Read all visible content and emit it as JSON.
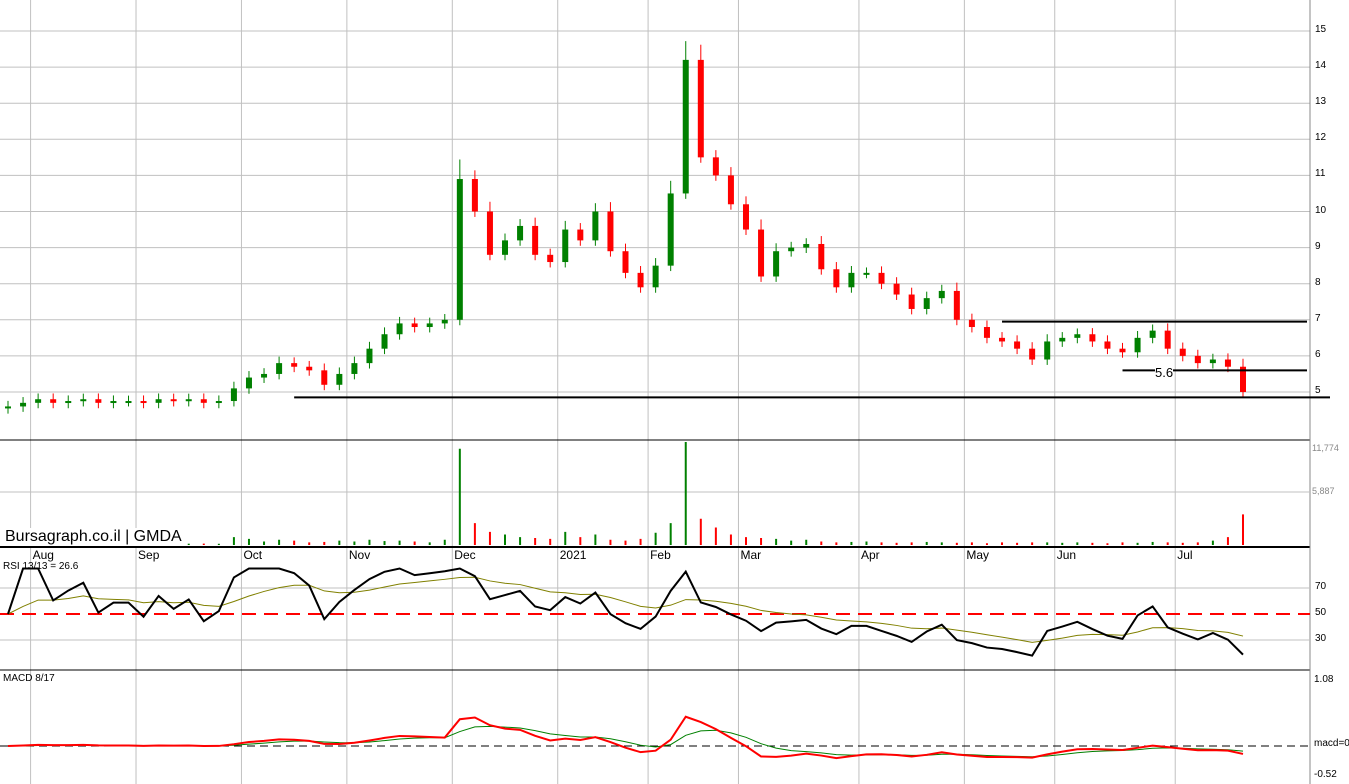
{
  "chart_data": {
    "type": "candlestick",
    "title": "GMDA",
    "brand": "Bursagraph.co.il | GMDA",
    "price_axis": {
      "ticks": [
        5,
        6,
        7,
        8,
        9,
        10,
        11,
        12,
        13,
        14,
        15
      ],
      "range": [
        4.2,
        15.6
      ]
    },
    "closes": [
      4.6,
      4.7,
      4.8,
      4.7,
      4.75,
      4.8,
      4.7,
      4.75,
      4.75,
      4.7,
      4.8,
      4.75,
      4.8,
      4.7,
      4.75,
      5.1,
      5.4,
      5.5,
      5.8,
      5.7,
      5.6,
      5.2,
      5.5,
      5.8,
      6.2,
      6.6,
      6.9,
      6.8,
      6.9,
      7.0,
      10.9,
      10.0,
      8.8,
      9.2,
      9.6,
      8.8,
      8.6,
      9.5,
      9.2,
      10.0,
      8.9,
      8.3,
      7.9,
      8.5,
      10.5,
      14.2,
      11.5,
      11.0,
      10.2,
      9.5,
      8.2,
      8.9,
      9.0,
      9.1,
      8.4,
      7.9,
      8.3,
      8.3,
      8.0,
      7.7,
      7.3,
      7.6,
      7.8,
      7.0,
      6.8,
      6.5,
      6.4,
      6.2,
      5.9,
      6.4,
      6.5,
      6.6,
      6.4,
      6.2,
      6.1,
      6.5,
      6.7,
      6.2,
      6.0,
      5.8,
      5.9,
      5.7,
      5.0
    ],
    "volumes": [
      200,
      150,
      300,
      250,
      200,
      180,
      220,
      160,
      150,
      200,
      180,
      170,
      150,
      160,
      140,
      900,
      700,
      400,
      600,
      500,
      300,
      350,
      500,
      400,
      600,
      450,
      500,
      400,
      300,
      600,
      11000,
      2500,
      1500,
      1200,
      900,
      800,
      700,
      1500,
      900,
      1200,
      600,
      500,
      700,
      1400,
      2500,
      11774,
      3000,
      2000,
      1200,
      900,
      800,
      700,
      500,
      600,
      400,
      300,
      350,
      400,
      300,
      250,
      300,
      350,
      300,
      250,
      300,
      200,
      300,
      250,
      300,
      300,
      250,
      300,
      250,
      200,
      300,
      250,
      350,
      300,
      250,
      300,
      500,
      900,
      3500
    ],
    "volume_axis": {
      "ticks": [
        "11,774",
        "5,887"
      ],
      "max": 11774
    },
    "months": [
      {
        "label": "Aug",
        "index": 2
      },
      {
        "label": "Sep",
        "index": 9
      },
      {
        "label": "Oct",
        "index": 16
      },
      {
        "label": "Nov",
        "index": 23
      },
      {
        "label": "Dec",
        "index": 30
      },
      {
        "label": "2021",
        "index": 37
      },
      {
        "label": "Feb",
        "index": 43
      },
      {
        "label": "Mar",
        "index": 49
      },
      {
        "label": "Apr",
        "index": 57
      },
      {
        "label": "May",
        "index": 64
      },
      {
        "label": "Jun",
        "index": 70
      },
      {
        "label": "Jul",
        "index": 78
      }
    ],
    "levels": [
      {
        "value": 4.85,
        "from": 19
      },
      {
        "value": 6.95,
        "from": 66
      },
      {
        "value": 5.6,
        "from": 74,
        "label": "5.6"
      }
    ],
    "rsi": {
      "label": "RSI 13/13 = 26.6",
      "ticks": [
        70,
        50,
        30
      ],
      "reference": 50
    },
    "macd": {
      "label": "MACD 8/17",
      "ticks": [
        "1.08",
        "macd=0",
        "-0.52"
      ],
      "range": [
        -0.52,
        1.08
      ]
    },
    "colors": {
      "up": "#008000",
      "down": "#ff0000",
      "grid": "#c0c0c0",
      "signal": "#808000"
    }
  }
}
